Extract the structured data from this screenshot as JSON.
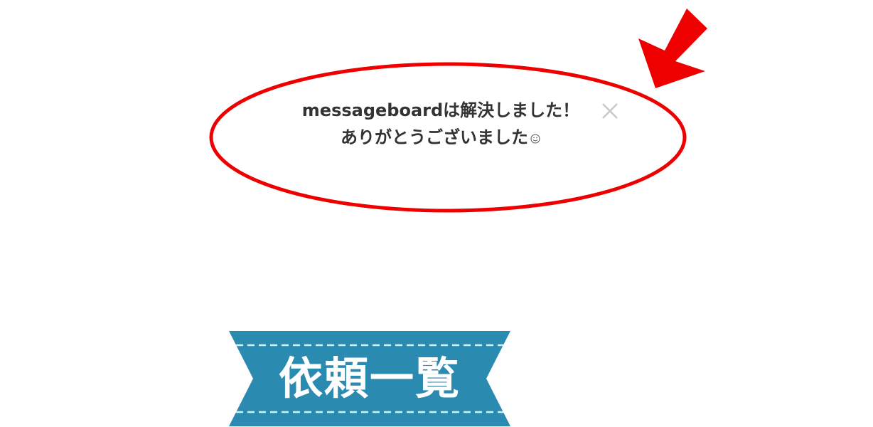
{
  "notice": {
    "line1": "messageboardは解決しました！",
    "line2": "ありがとうございました",
    "emoji_icon": "smile-icon",
    "close_icon": "close-icon",
    "close_label": "×"
  },
  "heading": {
    "title": "依頼一覧"
  },
  "colors": {
    "annotation_red": "#ee0000",
    "ribbon_blue": "#2a8ab0",
    "text": "#333333",
    "close_gray": "#c8c8c8"
  }
}
